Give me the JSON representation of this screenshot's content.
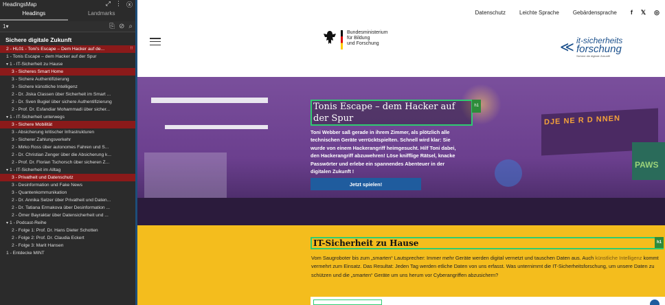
{
  "panel": {
    "title": "HeadingsMap",
    "tabs": [
      "Headings",
      "Landmarks"
    ],
    "level_select": "1▾",
    "doc_title": "Sichere digitale Zukunft",
    "items": [
      {
        "level": 1,
        "text": "2 - HL01 - Toni's Escape – Dem Hacker auf de...",
        "highlight": true,
        "badge": "!!"
      },
      {
        "level": 1,
        "text": "1 - Tonis Escape – dem Hacker auf der Spur"
      },
      {
        "level": 1,
        "text": "1 - IT-Sicherheit zu Hause",
        "caret": "▾"
      },
      {
        "level": 2,
        "text": "3 - Sicheres Smart Home",
        "highlight": true
      },
      {
        "level": 2,
        "text": "3 - Sichere Authentifizierung"
      },
      {
        "level": 2,
        "text": "3 - Sichere künstliche Intelligenz"
      },
      {
        "level": 2,
        "text": "2 - Dr. Jiska Classen über Sicherheit im Smart ..."
      },
      {
        "level": 2,
        "text": "2 - Dr. Sven Bugiel über sichere Authentifizierung"
      },
      {
        "level": 2,
        "text": "2 - Prof. Dr. Esfandiar Mohammadi über sicher..."
      },
      {
        "level": 1,
        "text": "1 - IT-Sicherheit unterwegs",
        "caret": "▾"
      },
      {
        "level": 2,
        "text": "3 - Sichere Mobilität",
        "highlight": true
      },
      {
        "level": 2,
        "text": "3 - Absicherung kritischer Infrastrukturen"
      },
      {
        "level": 2,
        "text": "3 - Sicherer Zahlungsverkehr"
      },
      {
        "level": 2,
        "text": "2 - Mirko Ross über autonomes Fahren und S..."
      },
      {
        "level": 2,
        "text": "2 - Dr. Christian Zenger über die Absicherung k..."
      },
      {
        "level": 2,
        "text": "2 - Prof. Dr. Florian Tschorsch über sicheren Z..."
      },
      {
        "level": 1,
        "text": "1 - IT-Sicherheit im Alltag",
        "caret": "▾"
      },
      {
        "level": 2,
        "text": "3 - Privatheit und Datenschutz",
        "highlight": true
      },
      {
        "level": 2,
        "text": "3 - Desinformation und Fake News"
      },
      {
        "level": 2,
        "text": "3 - Quantenkommunikation"
      },
      {
        "level": 2,
        "text": "2 - Dr. Annika Selzer über Privatheit und Daten..."
      },
      {
        "level": 2,
        "text": "2 - Dr. Tatiana Ermakova über Desinformation ..."
      },
      {
        "level": 2,
        "text": "2 - Ömer Bayraktar über Datensicherheit und ..."
      },
      {
        "level": 1,
        "text": "1 - Podcast-Reihe",
        "caret": "▾"
      },
      {
        "level": 2,
        "text": "2 - Folge 1: Prof. Dr. Hans Dieter Schotten"
      },
      {
        "level": 2,
        "text": "2 - Folge 2: Prof. Dr. Claudia Eckert"
      },
      {
        "level": 2,
        "text": "2 - Folge 3: Marit Hansen"
      },
      {
        "level": 1,
        "text": "1 - Entdecke MINT"
      }
    ]
  },
  "site": {
    "nav": [
      "Datenschutz",
      "Leichte Sprache",
      "Gebärdensprache"
    ],
    "social": [
      "f",
      "𝕏",
      "◎"
    ],
    "bmbf": [
      "Bundesministerium",
      "für Bildung",
      "und Forschung"
    ],
    "itsf": {
      "line1": "it-sicherheits",
      "line2": "forschung",
      "tagline": "Sichere die digitale Zukunft!"
    },
    "hero": {
      "title": "Tonis Escape – dem Hacker auf der Spur",
      "tag": "h1",
      "text": "Toni Webber saß gerade in ihrem Zimmer, als plötzlich alle technischen Geräte verrücktspielten. Schnell wird klar: Sie wurde von einem Hackerangriff heimgesucht. Hilf Toni dabei, den Hackerangriff abzuwehren! Löse knifflige Rätsel, knacke Passwörter und erlebe ein spannendes Abenteuer in der digitalen Zukunft !",
      "cta": "Jetzt spielen!",
      "poster_text": "DJE NE R D NNEN",
      "poster2_text": "PAWS"
    },
    "section": {
      "title": "IT-Sicherheit zu Hause",
      "tag": "h1",
      "text_before": "Vom Saugroboter bis zum „smarten“ Lautsprecher: Immer mehr Geräte werden digital vernetzt und tauschen Daten aus. Auch ",
      "link": "künstliche Intelligenz",
      "text_after": " kommt vermehrt zum Einsatz. Das Resultat: Jeden Tag werden etliche Daten von uns erfasst. Was unternimmt die IT-Sicherheitsforschung, um unsere Daten zu schützen und die „smarten“ Geräte um uns herum vor Cyberangriffen abzusichern?"
    }
  }
}
